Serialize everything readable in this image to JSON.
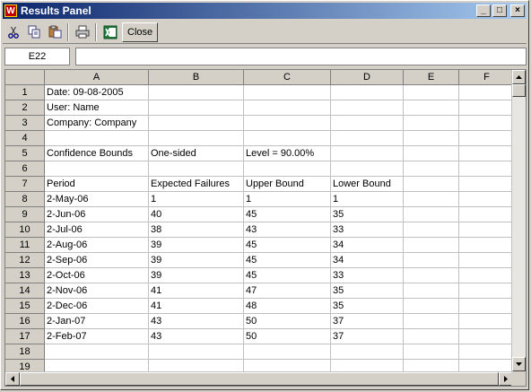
{
  "window": {
    "title": "Results Panel",
    "app_icon_letter": "W",
    "minimize": "_",
    "maximize": "□",
    "close": "×"
  },
  "toolbar": {
    "close_label": "Close"
  },
  "formula": {
    "name_box": "E22",
    "value": ""
  },
  "sheet": {
    "columns": [
      "A",
      "B",
      "C",
      "D",
      "E",
      "F"
    ],
    "rows": [
      {
        "num": "1",
        "cells": [
          "Date:    09-08-2005",
          "",
          "",
          "",
          "",
          ""
        ]
      },
      {
        "num": "2",
        "cells": [
          "User:    Name",
          "",
          "",
          "",
          "",
          ""
        ]
      },
      {
        "num": "3",
        "cells": [
          "Company: Company",
          "",
          "",
          "",
          "",
          ""
        ]
      },
      {
        "num": "4",
        "cells": [
          "",
          "",
          "",
          "",
          "",
          ""
        ]
      },
      {
        "num": "5",
        "cells": [
          "Confidence Bounds",
          "One-sided",
          "Level = 90.00%",
          "",
          "",
          ""
        ]
      },
      {
        "num": "6",
        "cells": [
          "",
          "",
          "",
          "",
          "",
          ""
        ]
      },
      {
        "num": "7",
        "cells": [
          "Period",
          "Expected Failures",
          "Upper Bound",
          "Lower Bound",
          "",
          ""
        ]
      },
      {
        "num": "8",
        "cells": [
          "2-May-06",
          "1",
          "1",
          "1",
          "",
          ""
        ]
      },
      {
        "num": "9",
        "cells": [
          "2-Jun-06",
          "40",
          "45",
          "35",
          "",
          ""
        ]
      },
      {
        "num": "10",
        "cells": [
          "2-Jul-06",
          "38",
          "43",
          "33",
          "",
          ""
        ]
      },
      {
        "num": "11",
        "cells": [
          "2-Aug-06",
          "39",
          "45",
          "34",
          "",
          ""
        ]
      },
      {
        "num": "12",
        "cells": [
          "2-Sep-06",
          "39",
          "45",
          "34",
          "",
          ""
        ]
      },
      {
        "num": "13",
        "cells": [
          "2-Oct-06",
          "39",
          "45",
          "33",
          "",
          ""
        ]
      },
      {
        "num": "14",
        "cells": [
          "2-Nov-06",
          "41",
          "47",
          "35",
          "",
          ""
        ]
      },
      {
        "num": "15",
        "cells": [
          "2-Dec-06",
          "41",
          "48",
          "35",
          "",
          ""
        ]
      },
      {
        "num": "16",
        "cells": [
          "2-Jan-07",
          "43",
          "50",
          "37",
          "",
          ""
        ]
      },
      {
        "num": "17",
        "cells": [
          "2-Feb-07",
          "43",
          "50",
          "37",
          "",
          ""
        ]
      },
      {
        "num": "18",
        "cells": [
          "",
          "",
          "",
          "",
          "",
          ""
        ]
      },
      {
        "num": "19",
        "cells": [
          "",
          "",
          "",
          "",
          "",
          ""
        ]
      }
    ]
  },
  "colors": {
    "title_start": "#0a246a",
    "title_end": "#a6caf0",
    "excel_green": "#1d7a3a"
  }
}
